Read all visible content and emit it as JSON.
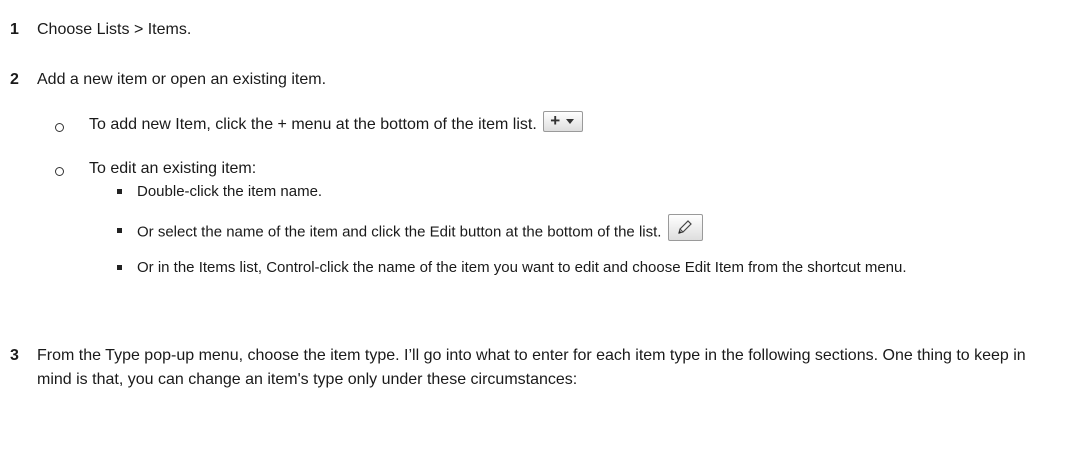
{
  "steps": [
    {
      "num": "1",
      "text": "Choose Lists > Items."
    },
    {
      "num": "2",
      "text": "Add a new item or open an existing item."
    },
    {
      "num": "3",
      "text": "From the Type pop-up menu, choose the item type. I’ll go into what to enter for each item type in the following sections. One thing to keep in mind is that, you can change an item's type only under these circumstances:"
    }
  ],
  "sub_items": [
    {
      "text": "To add new Item, click the + menu at the bottom of the item list."
    },
    {
      "text": "To edit an existing item:"
    }
  ],
  "bullets": [
    {
      "text": "Double-click the item name."
    },
    {
      "text": "Or select the name of the item and click the Edit button at the bottom of the list."
    },
    {
      "text": "Or in the Items list, Control-click the name of the item you want to edit and choose Edit Item from the shortcut menu."
    }
  ],
  "icons": {
    "add_menu": {
      "name": "add-menu-icon",
      "plus_glyph": "+"
    },
    "edit": {
      "name": "pencil-icon"
    }
  }
}
